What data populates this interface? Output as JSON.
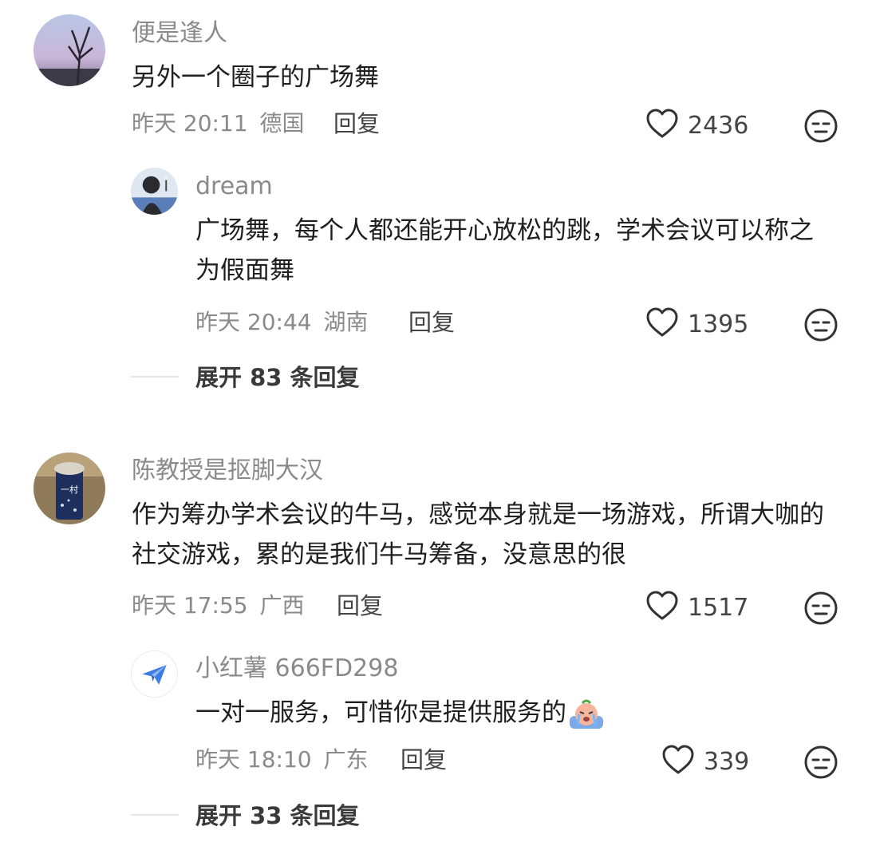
{
  "comments": [
    {
      "username": "便是逢人",
      "text": "另外一个圈子的广场舞",
      "time": "昨天 20:11",
      "location": "德国",
      "reply_label": "回复",
      "likes": "2436",
      "replies": [
        {
          "username": "dream",
          "text": "广场舞，每个人都还能开心放松的跳，学术会议可以称之为假面舞",
          "time": "昨天 20:44",
          "location": "湖南",
          "reply_label": "回复",
          "likes": "1395"
        }
      ],
      "expand_label": "展开 83 条回复"
    },
    {
      "username": "陈教授是抠脚大汉",
      "text": "作为筹办学术会议的牛马，感觉本身就是一场游戏，所谓大咖的社交游戏，累的是我们牛马筹备，没意思的很",
      "time": "昨天 17:55",
      "location": "广西",
      "reply_label": "回复",
      "likes": "1517",
      "avatar_text": "一村",
      "replies": [
        {
          "username": "小红薯 666FD298",
          "text": "一对一服务，可惜你是提供服务的",
          "time": "昨天 18:10",
          "location": "广东",
          "reply_label": "回复",
          "likes": "339"
        }
      ],
      "expand_label": "展开 33 条回复"
    }
  ],
  "icons": {
    "like": "heart-outline-icon",
    "dislike": "meh-face-icon",
    "emoji": "crying-emoji-icon",
    "default_avatar": "paper-plane-icon"
  },
  "colors": {
    "text": "#1f1f1f",
    "meta": "#8a8a8a",
    "divider": "#e5e5e5",
    "plane": "#3b7de0"
  }
}
